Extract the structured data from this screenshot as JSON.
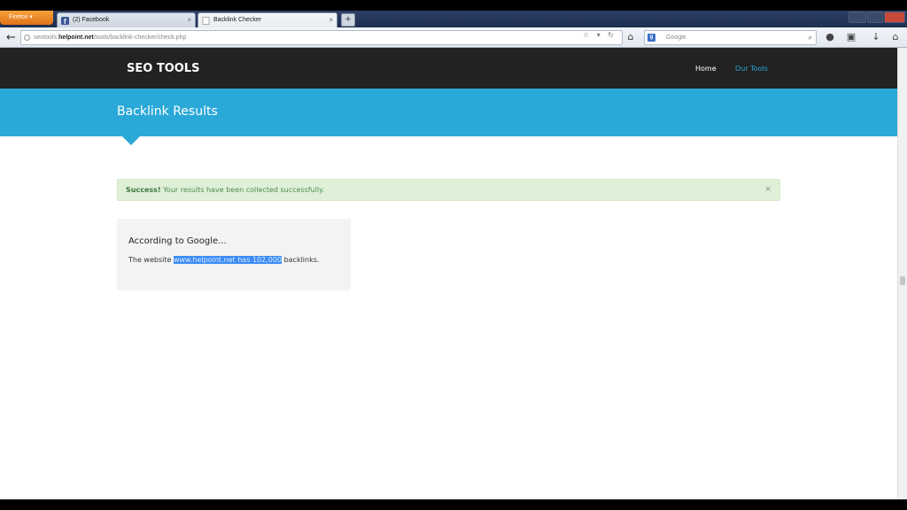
{
  "browser": {
    "app_button": "Firefox",
    "tabs": [
      {
        "label": "(2) Facebook",
        "active": false
      },
      {
        "label": "Backlink Checker",
        "active": true
      }
    ],
    "url": {
      "prefix": "seotools.",
      "host": "helpoint.net",
      "path": "/tools/backlink-checker/check.php"
    },
    "search_placeholder": "Google"
  },
  "site": {
    "brand": "SEO TOOLS",
    "nav": [
      {
        "label": "Home"
      },
      {
        "label": "Our Tools"
      }
    ],
    "page_title": "Backlink Results",
    "alert": {
      "strong": "Success!",
      "message": "Your results have been collected successfully.",
      "close": "×"
    },
    "result": {
      "heading": "According to Google...",
      "text_before": "The website",
      "text_highlighted": "www.helpoint.net has 102,000",
      "text_after": "backlinks."
    }
  },
  "colors": {
    "header_bg": "#222222",
    "banner_bg": "#2aa8d8",
    "nav_active": "#2aa8d8",
    "alert_bg": "#dff0d8",
    "panel_bg": "#f3f3f3",
    "selection": "#3b8cf5"
  }
}
